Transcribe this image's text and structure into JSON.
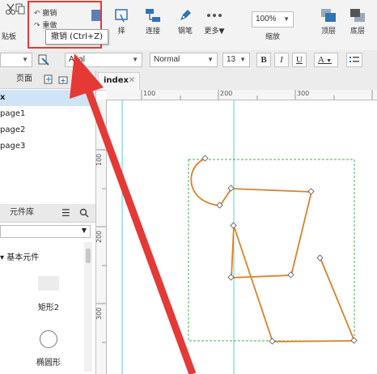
{
  "toolbar": {
    "clipboard_label": "贴板",
    "undo_label": "撤销",
    "redo_label": "重做",
    "tooltip": "撤销 (Ctrl+Z)",
    "partial_label": "择",
    "connect_label": "连接",
    "pen_label": "钢笔",
    "more_label": "更多▼",
    "zoom_value": "100%",
    "zoom_label": "缩放",
    "top_label": "顶层",
    "bottom_label": "底层"
  },
  "formatbar": {
    "font_value": "Arial",
    "style_value": "Normal",
    "size_value": "13",
    "bold": "B",
    "italic": "I",
    "underline": "U",
    "font_color": "A"
  },
  "pages_panel": {
    "title": "页面",
    "items": [
      "x",
      "page1",
      "page2",
      "page3"
    ]
  },
  "widgets_panel": {
    "title": "元件库",
    "section": "基本元件",
    "widgets": [
      "矩形2",
      "椭圆形"
    ]
  },
  "canvas": {
    "tab_label": "index",
    "ruler_h": [
      "100",
      "200",
      "300"
    ],
    "ruler_v": [
      "100",
      "200",
      "300"
    ]
  },
  "colors": {
    "annotation_red": "#e53935",
    "guide_cyan": "#4dd0e1",
    "shape_orange": "#d9822b",
    "selection_green": "#4caf50"
  }
}
